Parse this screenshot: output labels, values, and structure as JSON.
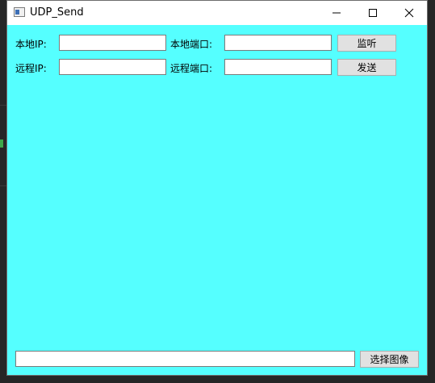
{
  "window": {
    "title": "UDP_Send",
    "icon": "app-window-icon",
    "controls": [
      "minimize-icon",
      "maximize-icon",
      "close-icon"
    ]
  },
  "form": {
    "local_ip_label": "本地IP:",
    "local_ip_value": "",
    "local_port_label": "本地端口:",
    "local_port_value": "",
    "listen_button": "监听",
    "remote_ip_label": "远程IP:",
    "remote_ip_value": "",
    "remote_port_label": "远程端口:",
    "remote_port_value": "",
    "send_button": "发送"
  },
  "footer": {
    "image_path_value": "",
    "select_image_button": "选择图像"
  },
  "colors": {
    "client_background": "#55ffff",
    "titlebar": "#ffffff",
    "button_face": "#e1e1e1"
  }
}
